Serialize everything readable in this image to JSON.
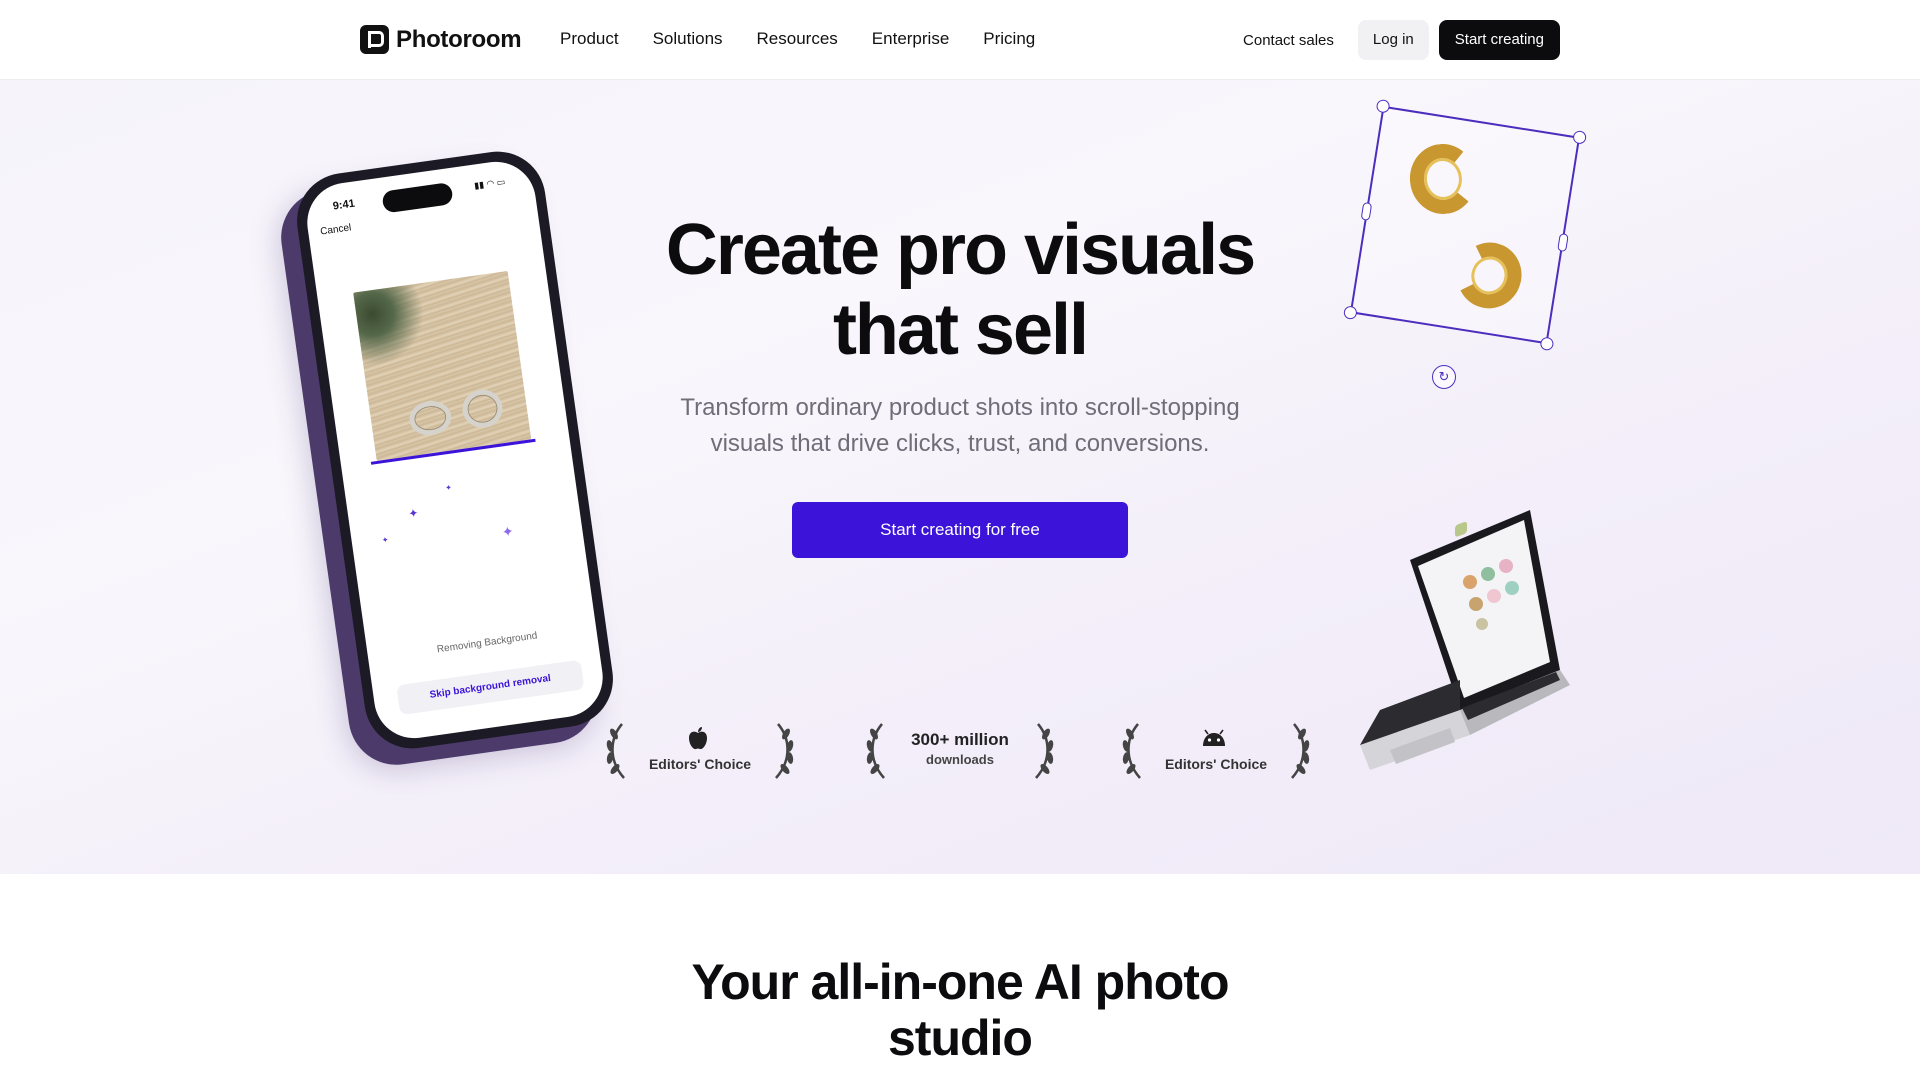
{
  "nav": {
    "brand": "Photoroom",
    "menu": [
      "Product",
      "Solutions",
      "Resources",
      "Enterprise",
      "Pricing"
    ],
    "contact_label": "Contact sales",
    "login_label": "Log in",
    "start_label": "Start creating"
  },
  "hero": {
    "headline_line1": "Create pro visuals",
    "headline_line2": "that sell",
    "subtitle_line1": "Transform ordinary product shots into scroll-stopping",
    "subtitle_line2": "visuals that drive clicks, trust, and conversions.",
    "cta_label": "Start creating for free"
  },
  "awards": [
    {
      "icon": "apple-icon",
      "label": "Editors' Choice"
    },
    {
      "big": "300+ million",
      "small": "downloads"
    },
    {
      "icon": "android-icon",
      "label": "Editors' Choice"
    }
  ],
  "phone": {
    "time": "9:41",
    "cancel": "Cancel",
    "status_text": "Removing Background",
    "skip_label": "Skip background removal"
  },
  "section2": {
    "title_line1": "Your all-in-one AI photo",
    "title_line2": "studio"
  },
  "colors": {
    "accent": "#3c13d9",
    "selection": "#4d2dbd",
    "dark": "#0c0c0e"
  }
}
